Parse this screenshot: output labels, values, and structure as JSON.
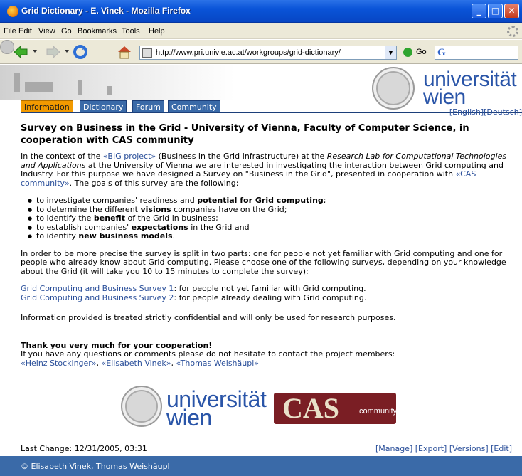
{
  "window": {
    "title": "Grid Dictionary - E. Vinek - Mozilla Firefox"
  },
  "menu": [
    "File",
    "Edit",
    "View",
    "Go",
    "Bookmarks",
    "Tools",
    "Help"
  ],
  "toolbar": {
    "url": "http://www.pri.univie.ac.at/workgroups/grid-dictionary/",
    "go_label": "Go",
    "search_logo": "G"
  },
  "logo": {
    "line1": "universität",
    "line2": "wien"
  },
  "tabs": [
    "Information",
    "Dictionary",
    "Forum",
    "Community"
  ],
  "languages": {
    "english": "[English]",
    "deutsch": "[Deutsch]"
  },
  "article": {
    "title": "Survey on Business in the Grid - University of Vienna, Faculty of Computer Science, in cooperation with CAS community",
    "intro": {
      "t1": "In the context of the ",
      "link1": "«BIG project»",
      "t2": " (Business in the Grid Infrastructure) at the ",
      "italic": "Research Lab for Computational Technologies and Applications",
      "t3": " at the University of Vienna we are interested in investigating the interaction between Grid computing and Industry. For this purpose we have designed a Survey on \"Business in the Grid\", presented in cooperation with ",
      "link2": "«CAS community»",
      "t4": ". The goals of this survey are the following:"
    },
    "goals": [
      {
        "pre": "to investigate companies' readiness and ",
        "bold": "potential for Grid computing",
        "post": ";"
      },
      {
        "pre": "to determine the different ",
        "bold": "visions",
        "post": " companies have on the Grid;"
      },
      {
        "pre": "to identify the ",
        "bold": "benefit",
        "post": " of the Grid in business;"
      },
      {
        "pre": "to establish companies' ",
        "bold": "expectations",
        "post": " in the Grid and"
      },
      {
        "pre": "to identify ",
        "bold": "new business models",
        "post": "."
      }
    ],
    "split_text": "In order to be more precise the survey is split in two parts: one for people not yet familiar with Grid computing and one for people who already know about Grid computing. Please choose one of the following surveys, depending on your knowledge about the Grid (it will take you 10 to 15 minutes to complete the survey):",
    "survey1_link": "Grid Computing and Business Survey 1",
    "survey1_text": ": for people not yet familiar with Grid computing.",
    "survey2_link": "Grid Computing and Business Survey 2",
    "survey2_text": ": for people already dealing with Grid computing.",
    "confidential": "Information provided is treated strictly confidential and will only be used for research purposes.",
    "thanks": "Thank you very much for your cooperation!",
    "contact": "If you have any questions or comments please do not hesitate to contact the project members:",
    "members": [
      "«Heinz Stockinger»",
      "«Elisabeth Vinek»",
      "«Thomas Weishäupl»"
    ]
  },
  "cas_logo": {
    "main": "CAS",
    "sub": "community"
  },
  "last_change": "Last Change: 12/31/2005, 03:31",
  "actions": [
    "[Manage]",
    "[Export]",
    "[Versions]",
    "[Edit]"
  ],
  "footer": "© Elisabeth Vinek, Thomas Weishäupl"
}
